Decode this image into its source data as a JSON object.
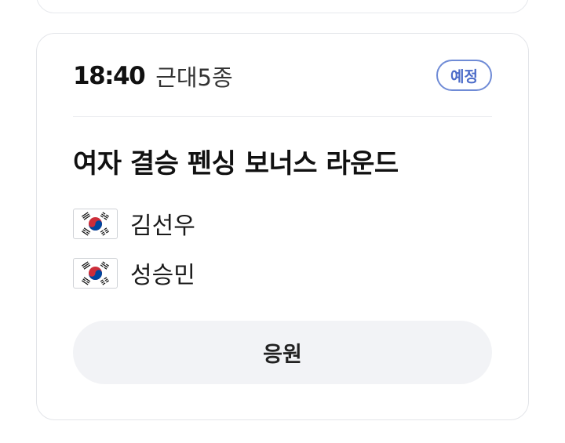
{
  "match": {
    "time": "18:40",
    "sport": "근대5종",
    "status": "예정",
    "title": "여자 결승 펜싱 보너스 라운드",
    "athletes": [
      {
        "name": "김선우",
        "flag_icon": "south-korea-flag-icon"
      },
      {
        "name": "성승민",
        "flag_icon": "south-korea-flag-icon"
      }
    ],
    "cheer_label": "응원"
  },
  "colors": {
    "badge_border": "#6f8bd6",
    "badge_text": "#4c6cc9",
    "button_bg": "#f2f3f6",
    "flag_red": "#cd2e3a",
    "flag_blue": "#0047a0"
  }
}
